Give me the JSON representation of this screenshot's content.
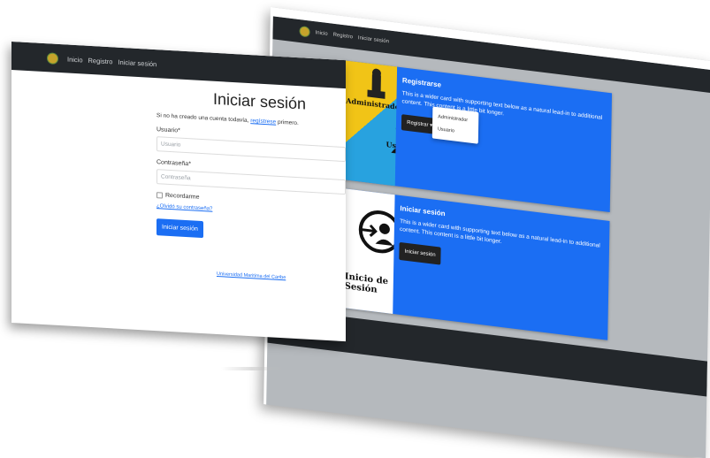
{
  "front": {
    "nav": {
      "logo_icon": "university-seal-icon",
      "items": [
        "Inicio",
        "Registro",
        "Iniciar sesión"
      ]
    },
    "title": "Iniciar sesión",
    "intro_prefix": "Si no ha creado una cuenta todavía,",
    "intro_link": "regístrese",
    "intro_suffix": "primero.",
    "username_label": "Usuario*",
    "username_placeholder": "Usuario",
    "password_label": "Contraseña*",
    "password_placeholder": "Contraseña",
    "remember_label": "Recordarme",
    "forgot_link": "¿Olvidó su contraseña?",
    "submit_label": "Iniciar sesión",
    "footer_link": "Universidad Maritima del Caribe"
  },
  "back": {
    "nav": {
      "logo_icon": "university-seal-icon",
      "items": [
        "Inicio",
        "Registro",
        "Iniciar sesión"
      ]
    },
    "cards": [
      {
        "image_labels": [
          "Administrador",
          "Usuario"
        ],
        "title": "Registrarse",
        "text": "This is a wider card with supporting text below as a natural lead-in to additional content. This content is a little bit longer.",
        "button": "Registrar",
        "dropdown": [
          "Administrador",
          "Usuario"
        ]
      },
      {
        "image_labels": [
          "Inicio de Sesión"
        ],
        "title": "Iniciar sesión",
        "text": "This is a wider card with supporting text below as a natural lead-in to additional content. This content is a little bit longer.",
        "button": "Iniciar sesión"
      }
    ]
  },
  "colors": {
    "primary": "#1b6ef3",
    "navbar": "#23272b",
    "yellow": "#f1c417",
    "cyan": "#28a2df"
  }
}
